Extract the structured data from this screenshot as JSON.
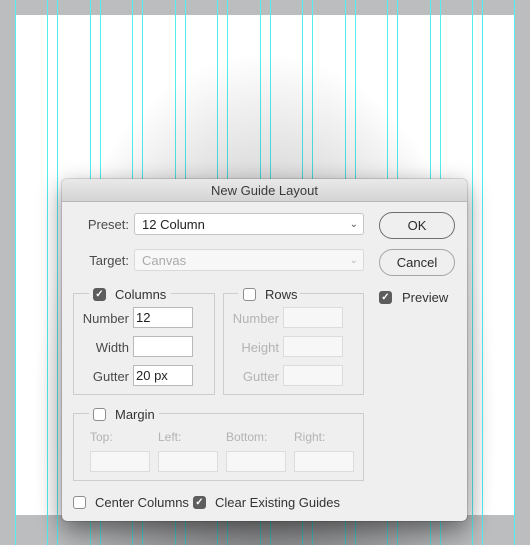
{
  "dialog": {
    "title": "New Guide Layout",
    "preset_label": "Preset:",
    "preset_value": "12 Column",
    "target_label": "Target:",
    "target_value": "Canvas",
    "ok_label": "OK",
    "cancel_label": "Cancel",
    "preview_label": "Preview",
    "preview_checked": true,
    "columns": {
      "label": "Columns",
      "checked": true,
      "number_label": "Number",
      "number_value": "12",
      "width_label": "Width",
      "width_value": "",
      "gutter_label": "Gutter",
      "gutter_value": "20 px"
    },
    "rows": {
      "label": "Rows",
      "checked": false,
      "number_label": "Number",
      "height_label": "Height",
      "gutter_label": "Gutter"
    },
    "margin": {
      "label": "Margin",
      "checked": false,
      "top_label": "Top:",
      "left_label": "Left:",
      "bottom_label": "Bottom:",
      "right_label": "Right:"
    },
    "center_columns_label": "Center Columns",
    "center_columns_checked": false,
    "clear_guides_label": "Clear Existing Guides",
    "clear_guides_checked": true
  },
  "icons": {
    "chevron": "⌄",
    "check": "✓"
  },
  "colors": {
    "guide": "#52eef0",
    "canvas": "#ffffff",
    "pasteboard": "#bcbdbf"
  }
}
